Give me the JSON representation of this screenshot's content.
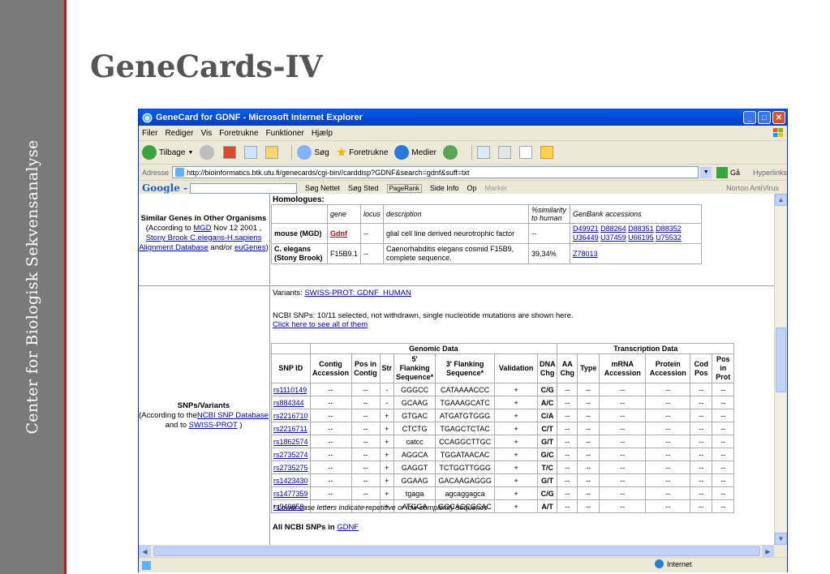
{
  "slide": {
    "sidebar_text": "Center for Biologisk Sekvensanalyse",
    "title": "GeneCards-IV"
  },
  "browser": {
    "window_title": "GeneCard for GDNF - Microsoft Internet Explorer",
    "menu": [
      "Filer",
      "Rediger",
      "Vis",
      "Foretrukne",
      "Funktioner",
      "Hjælp"
    ],
    "toolbar": {
      "back": "Tilbage",
      "search": "Søg",
      "favorites": "Foretrukne",
      "media": "Medier"
    },
    "address_label": "Adresse",
    "address_url": "http://bioinformatics.btk.utu.fi/genecards/cgi-bin//carddisp?GDNF&search=gdnf&suff=txt",
    "go_label": "Gå",
    "links_label": "Hyperlinks",
    "google": {
      "logo": "Google -",
      "search_web": "Søg Nettet",
      "search_site": "Søg Sted",
      "pagerank": "PageRank",
      "page_info": "Side Info",
      "up": "Op",
      "highlight": "Markér",
      "norton": "Norton AntiVirus"
    },
    "status": {
      "zone": "Internet"
    }
  },
  "similar": {
    "header": "Similar Genes in Other Organisms",
    "according_prefix": "(According to ",
    "mgd": "MGD",
    "date": " Nov 12 2001 , ",
    "stony": "Stony Brook C.elegans-H.sapiens Alignment Database",
    "and": " and/or ",
    "eugenes": "euGenes",
    "close": ")"
  },
  "homologues": {
    "title": "Homologues:",
    "columns": [
      "gene",
      "locus",
      "description",
      "%similarity to human",
      "GenBank accessions"
    ],
    "rows": [
      {
        "organism": "mouse (MGD)",
        "gene": "Gdnf",
        "locus": "--",
        "description": "glial cell line derived neurotrophic factor",
        "similarity": "--",
        "accessions": [
          "D49921",
          "D88264",
          "D88351",
          "D88352",
          "U36449",
          "U37459",
          "U66195",
          "U75532"
        ]
      },
      {
        "organism": "C. elegans (Stony Brook)",
        "gene": "F15B9.1",
        "locus": "--",
        "description": "Caenorhabditis elegans cosmid F15B9, complete sequence.",
        "similarity": "39,34%",
        "accessions": [
          "Z78013"
        ]
      }
    ]
  },
  "snps": {
    "left_title": "SNPs/Variants",
    "left_according": "(According to the",
    "left_ncbi": "NCBI SNP Database",
    "left_and": " and to ",
    "left_swiss": "SWISS-PROT",
    "left_close": " )",
    "variants_prefix": "Variants: ",
    "variants_link": "SWISS-PROT: GDNF_HUMAN",
    "ncbi_text": "NCBI SNPs: 10/11 selected, not withdrawn, single nucleotide mutations are shown here.",
    "click_here": "Click here to see all of them",
    "group_genomic": "Genomic Data",
    "group_transcription": "Transcription Data",
    "columns": [
      "SNP ID",
      "Contig Accession",
      "Pos in Contig",
      "Str",
      "5' Flanking Sequence*",
      "3' Flanking Sequence*",
      "Validation",
      "DNA Chg",
      "AA Chg",
      "Type",
      "mRNA Accession",
      "Protein Accession",
      "Cod Pos",
      "Pos in Prot"
    ],
    "rows": [
      [
        "rs1110149",
        "--",
        "--",
        "-",
        "GGGCC",
        "CATAAAACCC",
        "+",
        "C/G",
        "--",
        "--",
        "--",
        "--",
        "--",
        "--"
      ],
      [
        "rs884344",
        "--",
        "--",
        "-",
        "GCAAG",
        "TGAAAGCATC",
        "+",
        "A/C",
        "--",
        "--",
        "--",
        "--",
        "--",
        "--"
      ],
      [
        "rs2216710",
        "--",
        "--",
        "+",
        "GTGAC",
        "ATGATGTGGG",
        "+",
        "C/A",
        "--",
        "--",
        "--",
        "--",
        "--",
        "--"
      ],
      [
        "rs2216711",
        "--",
        "--",
        "+",
        "CTCTG",
        "TGAGCTCTAC",
        "+",
        "C/T",
        "--",
        "--",
        "--",
        "--",
        "--",
        "--"
      ],
      [
        "rs1862574",
        "--",
        "--",
        "+",
        "catcc",
        "CCAGGCTTGC",
        "+",
        "G/T",
        "--",
        "--",
        "--",
        "--",
        "--",
        "--"
      ],
      [
        "rs2735274",
        "--",
        "--",
        "+",
        "AGGCA",
        "TGGATAACAC",
        "+",
        "G/C",
        "--",
        "--",
        "--",
        "--",
        "--",
        "--"
      ],
      [
        "rs2735275",
        "--",
        "--",
        "+",
        "GAGGT",
        "TCTGGTTGGG",
        "+",
        "T/C",
        "--",
        "--",
        "--",
        "--",
        "--",
        "--"
      ],
      [
        "rs1423430",
        "--",
        "--",
        "+",
        "GGAAG",
        "GACAAGAGGG",
        "+",
        "G/T",
        "--",
        "--",
        "--",
        "--",
        "--",
        "--"
      ],
      [
        "rs1477359",
        "--",
        "--",
        "+",
        "tgaga",
        "agcaggagca",
        "+",
        "C/G",
        "--",
        "--",
        "--",
        "--",
        "--",
        "--"
      ],
      [
        "rs949859",
        "--",
        "--",
        "+",
        "ATGGA",
        "GGCACCGCAC",
        "+",
        "A/T",
        "--",
        "--",
        "--",
        "--",
        "--",
        "--"
      ]
    ],
    "footnote": "* Lower case letters indicate repetitive or low-complexity sequence",
    "all_prefix": "All NCBI SNPs in ",
    "all_link": "GDNF"
  },
  "colors": {
    "sidebar": "#7a7a7a",
    "accent_red": "#c8141e",
    "xp_blue": "#0046d5",
    "link": "#0000cc"
  }
}
